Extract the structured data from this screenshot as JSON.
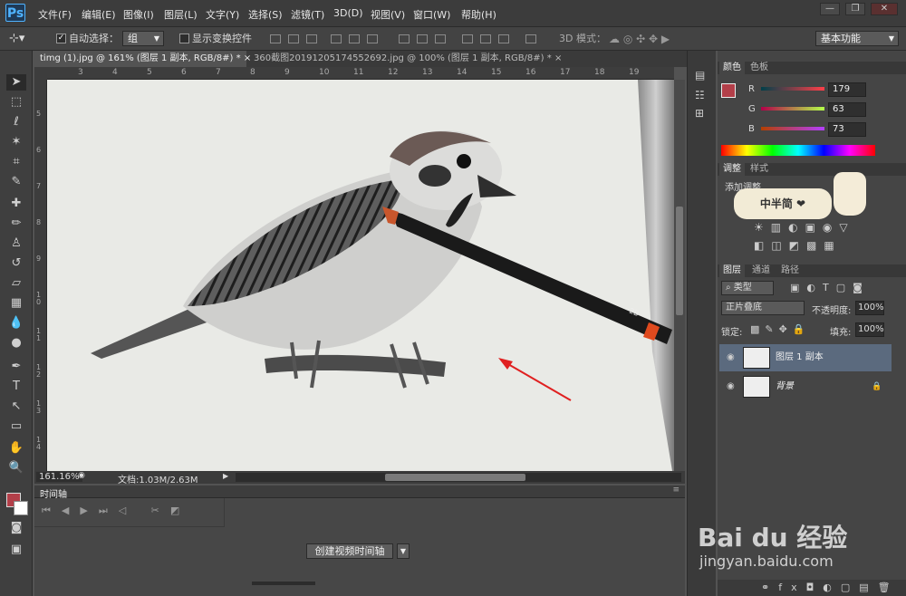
{
  "app": {
    "logo": "Ps"
  },
  "menu": [
    "文件(F)",
    "编辑(E)",
    "图像(I)",
    "图层(L)",
    "文字(Y)",
    "选择(S)",
    "滤镜(T)",
    "3D(D)",
    "视图(V)",
    "窗口(W)",
    "帮助(H)"
  ],
  "window_controls": {
    "minimize": "—",
    "restore": "❐",
    "close": "✕"
  },
  "options": {
    "auto_select_label": "自动选择：",
    "auto_select_value": "组",
    "show_transform_label": "显示变换控件",
    "mode3d_label": "3D 模式：",
    "workspace": "基本功能"
  },
  "tabs": [
    {
      "label": "timg (1).jpg @ 161% (图层 1 副本, RGB/8#) *",
      "close": "×"
    },
    {
      "label": "360截图20191205174552692.jpg @ 100% (图层 1 副本, RGB/8#) *",
      "close": "×"
    }
  ],
  "ruler_top": [
    "3",
    "4",
    "5",
    "6",
    "7",
    "8",
    "9",
    "10",
    "11",
    "12",
    "13",
    "14",
    "15",
    "16",
    "17",
    "18",
    "19"
  ],
  "ruler_left": [
    "5",
    "6",
    "7",
    "8",
    "9",
    "1 0",
    "1 1",
    "1 2",
    "1 3",
    "1 4"
  ],
  "canvas": {
    "pencil_text": "2B"
  },
  "status": {
    "zoom": "161.16%",
    "doc": "文档:1.03M/2.63M"
  },
  "timeline": {
    "title": "时间轴",
    "create_button": "创建视频时间轴"
  },
  "color_panel": {
    "tabs": [
      "颜色",
      "色板"
    ],
    "sliders": [
      {
        "label": "R",
        "value": "179"
      },
      {
        "label": "G",
        "value": "63"
      },
      {
        "label": "B",
        "value": "73"
      }
    ],
    "foreground": "#b33f49"
  },
  "adjust_panel": {
    "tabs": [
      "调整",
      "样式"
    ],
    "add_label": "添加调整",
    "sticker_text": "中半简 ❤"
  },
  "layers_panel": {
    "tabs": [
      "图层",
      "通道",
      "路径"
    ],
    "filter_label": "类型",
    "blend_mode": "正片叠底",
    "opacity_label": "不透明度:",
    "opacity_value": "100%",
    "lock_label": "锁定:",
    "fill_label": "填充:",
    "fill_value": "100%",
    "layers": [
      {
        "name": "图层 1 副本",
        "selected": true
      },
      {
        "name": "背景",
        "selected": false
      }
    ]
  },
  "watermark": {
    "brand": "Bai du 经验",
    "url": "jingyan.baidu.com"
  }
}
